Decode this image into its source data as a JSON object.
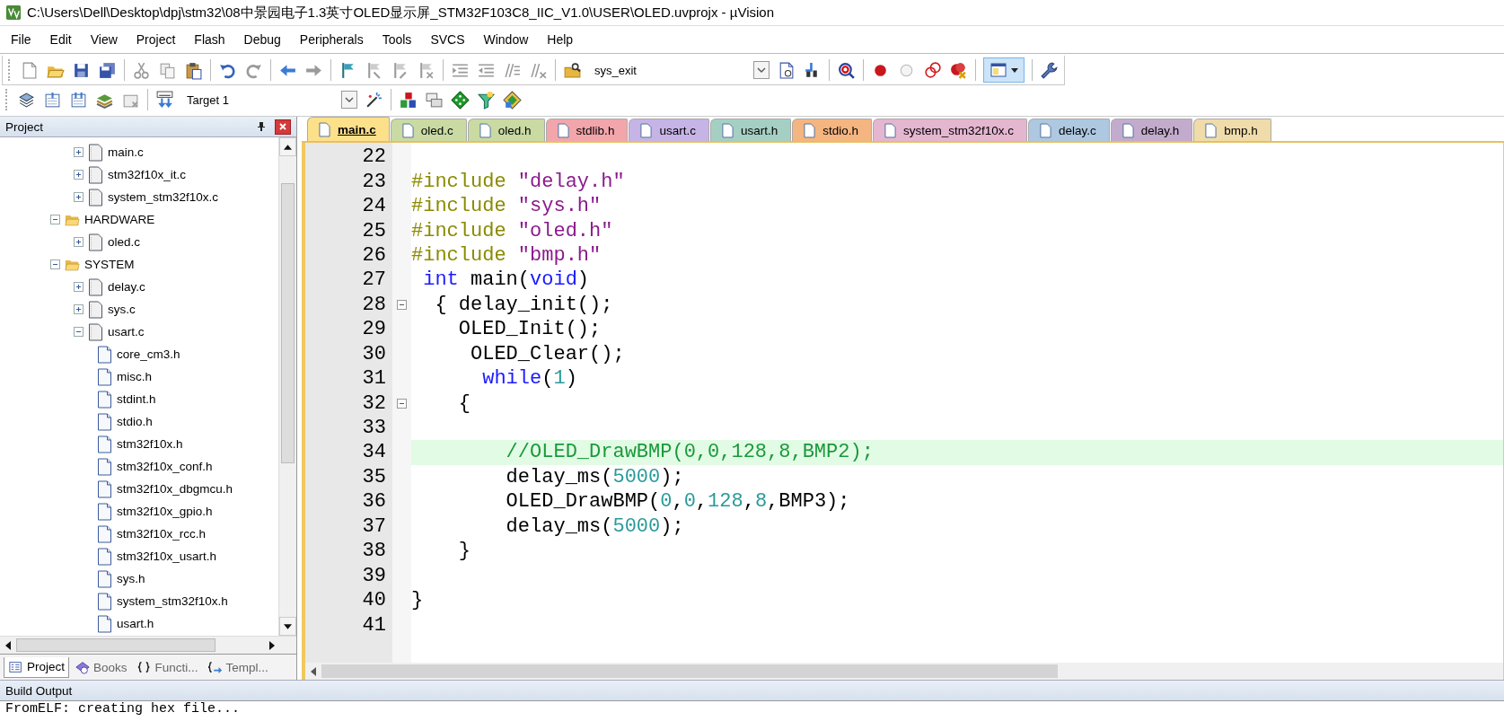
{
  "window": {
    "title": "C:\\Users\\Dell\\Desktop\\dpj\\stm32\\08中景园电子1.3英寸OLED显示屏_STM32F103C8_IIC_V1.0\\USER\\OLED.uvprojx - µVision"
  },
  "menu": [
    "File",
    "Edit",
    "View",
    "Project",
    "Flash",
    "Debug",
    "Peripherals",
    "Tools",
    "SVCS",
    "Window",
    "Help"
  ],
  "toolbar": {
    "function_combo": "sys_exit",
    "target_combo": "Target 1"
  },
  "project_panel": {
    "title": "Project",
    "tree": [
      {
        "children": [
          {
            "label": "main.c",
            "kind": "file",
            "expanded": false
          },
          {
            "label": "stm32f10x_it.c",
            "kind": "file",
            "expanded": false
          },
          {
            "label": "system_stm32f10x.c",
            "kind": "file",
            "expanded": false
          }
        ]
      },
      {
        "label": "HARDWARE",
        "kind": "folder",
        "expanded": true,
        "children": [
          {
            "label": "oled.c",
            "kind": "file",
            "expanded": false
          }
        ]
      },
      {
        "label": "SYSTEM",
        "kind": "folder",
        "expanded": true,
        "children": [
          {
            "label": "delay.c",
            "kind": "file",
            "expanded": false
          },
          {
            "label": "sys.c",
            "kind": "file",
            "expanded": false
          },
          {
            "label": "usart.c",
            "kind": "file",
            "expanded": true,
            "children": [
              {
                "label": "core_cm3.h",
                "kind": "header"
              },
              {
                "label": "misc.h",
                "kind": "header"
              },
              {
                "label": "stdint.h",
                "kind": "header"
              },
              {
                "label": "stdio.h",
                "kind": "header"
              },
              {
                "label": "stm32f10x.h",
                "kind": "header"
              },
              {
                "label": "stm32f10x_conf.h",
                "kind": "header"
              },
              {
                "label": "stm32f10x_dbgmcu.h",
                "kind": "header"
              },
              {
                "label": "stm32f10x_gpio.h",
                "kind": "header"
              },
              {
                "label": "stm32f10x_rcc.h",
                "kind": "header"
              },
              {
                "label": "stm32f10x_usart.h",
                "kind": "header"
              },
              {
                "label": "sys.h",
                "kind": "header"
              },
              {
                "label": "system_stm32f10x.h",
                "kind": "header"
              },
              {
                "label": "usart.h",
                "kind": "header"
              }
            ]
          }
        ]
      }
    ],
    "tabs": [
      {
        "label": "Project",
        "kind": "project",
        "selected": true
      },
      {
        "label": "Books",
        "kind": "books",
        "selected": false
      },
      {
        "label": "Functi...",
        "kind": "functions",
        "selected": false
      },
      {
        "label": "Templ...",
        "kind": "templates",
        "selected": false
      }
    ]
  },
  "editor": {
    "tabs": [
      {
        "label": "main.c",
        "color": "#fde08a",
        "selected": true
      },
      {
        "label": "oled.c",
        "color": "#c9daa3",
        "selected": false
      },
      {
        "label": "oled.h",
        "color": "#c9daa3",
        "selected": false
      },
      {
        "label": "stdlib.h",
        "color": "#f2a6ab",
        "selected": false
      },
      {
        "label": "usart.c",
        "color": "#c6b4e6",
        "selected": false
      },
      {
        "label": "usart.h",
        "color": "#a6cfc4",
        "selected": false
      },
      {
        "label": "stdio.h",
        "color": "#f5b580",
        "selected": false
      },
      {
        "label": "system_stm32f10x.c",
        "color": "#e4b6d0",
        "selected": false
      },
      {
        "label": "delay.c",
        "color": "#adc8e0",
        "selected": false
      },
      {
        "label": "delay.h",
        "color": "#c3abcd",
        "selected": false
      },
      {
        "label": "bmp.h",
        "color": "#f0dcaa",
        "selected": false
      }
    ],
    "lines": [
      {
        "number": "22",
        "fold": false
      },
      {
        "number": "23",
        "fold": false,
        "highlighted": false,
        "tokens": [
          {
            "kind": "pp",
            "text": "#include "
          },
          {
            "kind": "str",
            "text": "\"delay.h\""
          }
        ]
      },
      {
        "number": "24",
        "fold": false,
        "highlighted": false,
        "tokens": [
          {
            "kind": "pp",
            "text": "#include "
          },
          {
            "kind": "str",
            "text": "\"sys.h\""
          }
        ]
      },
      {
        "number": "25",
        "fold": false,
        "highlighted": false,
        "tokens": [
          {
            "kind": "pp",
            "text": "#include "
          },
          {
            "kind": "str",
            "text": "\"oled.h\""
          }
        ]
      },
      {
        "number": "26",
        "fold": false,
        "highlighted": false,
        "tokens": [
          {
            "kind": "pp",
            "text": "#include "
          },
          {
            "kind": "str",
            "text": "\"bmp.h\""
          }
        ]
      },
      {
        "number": "27",
        "fold": false,
        "highlighted": false,
        "tokens": [
          {
            "kind": "kw",
            "text": " int"
          },
          {
            "kind": "plain",
            "text": " main("
          },
          {
            "kind": "kw",
            "text": "void"
          },
          {
            "kind": "plain",
            "text": ")"
          }
        ]
      },
      {
        "number": "28",
        "fold": true,
        "highlighted": false,
        "tokens": [
          {
            "kind": "plain",
            "text": "  { delay_init();"
          }
        ]
      },
      {
        "number": "29",
        "fold": false,
        "highlighted": false,
        "tokens": [
          {
            "kind": "plain",
            "text": "    OLED_Init();"
          }
        ]
      },
      {
        "number": "30",
        "fold": false,
        "highlighted": false,
        "tokens": [
          {
            "kind": "plain",
            "text": "     OLED_Clear();"
          }
        ]
      },
      {
        "number": "31",
        "fold": false,
        "highlighted": false,
        "tokens": [
          {
            "kind": "kw",
            "text": "      while"
          },
          {
            "kind": "plain",
            "text": "("
          },
          {
            "kind": "num",
            "text": "1"
          },
          {
            "kind": "plain",
            "text": ")"
          }
        ]
      },
      {
        "number": "32",
        "fold": true,
        "highlighted": false,
        "tokens": [
          {
            "kind": "plain",
            "text": "    {"
          }
        ]
      },
      {
        "number": "33",
        "fold": false
      },
      {
        "number": "34",
        "fold": false,
        "highlighted": true,
        "tokens": [
          {
            "kind": "comment",
            "text": "        //OLED_DrawBMP(0,0,128,8,BMP2);"
          }
        ]
      },
      {
        "number": "35",
        "fold": false,
        "highlighted": false,
        "tokens": [
          {
            "kind": "plain",
            "text": "        delay_ms("
          },
          {
            "kind": "num",
            "text": "5000"
          },
          {
            "kind": "plain",
            "text": ");"
          }
        ]
      },
      {
        "number": "36",
        "fold": false,
        "highlighted": false,
        "tokens": [
          {
            "kind": "plain",
            "text": "        OLED_DrawBMP("
          },
          {
            "kind": "num",
            "text": "0"
          },
          {
            "kind": "plain",
            "text": ","
          },
          {
            "kind": "num",
            "text": "0"
          },
          {
            "kind": "plain",
            "text": ","
          },
          {
            "kind": "num",
            "text": "128"
          },
          {
            "kind": "plain",
            "text": ","
          },
          {
            "kind": "num",
            "text": "8"
          },
          {
            "kind": "plain",
            "text": ",BMP3);"
          }
        ]
      },
      {
        "number": "37",
        "fold": false,
        "highlighted": false,
        "tokens": [
          {
            "kind": "plain",
            "text": "        delay_ms("
          },
          {
            "kind": "num",
            "text": "5000"
          },
          {
            "kind": "plain",
            "text": ");"
          }
        ]
      },
      {
        "number": "38",
        "fold": false,
        "highlighted": false,
        "tokens": [
          {
            "kind": "plain",
            "text": "    }"
          }
        ]
      },
      {
        "number": "39",
        "fold": false
      },
      {
        "number": "40",
        "fold": false,
        "highlighted": false,
        "tokens": [
          {
            "kind": "plain",
            "text": "}"
          }
        ]
      },
      {
        "number": "41",
        "fold": false
      }
    ]
  },
  "build_output": {
    "title": "Build Output",
    "text": "FromELF: creating hex file..."
  }
}
